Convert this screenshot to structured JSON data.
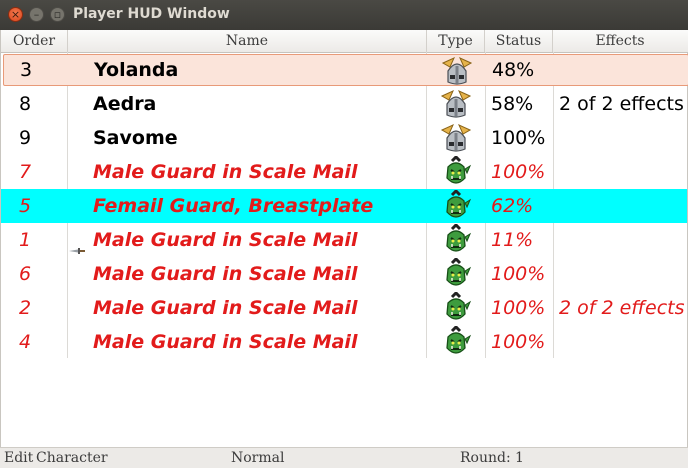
{
  "window": {
    "title": "Player HUD Window"
  },
  "columns": {
    "order": "Order",
    "name": "Name",
    "type": "Type",
    "status": "Status",
    "effects": "Effects"
  },
  "rows": [
    {
      "order": "3",
      "name": "Yolanda",
      "type": "adventurer-helmet-icon",
      "status": "48%",
      "effects": "",
      "style": "player",
      "state": "selected"
    },
    {
      "order": "8",
      "name": "Aedra",
      "type": "adventurer-helmet-icon",
      "status": "58%",
      "effects": "2 of 2 effects",
      "style": "player",
      "state": ""
    },
    {
      "order": "9",
      "name": "Savome",
      "type": "adventurer-helmet-icon",
      "status": "100%",
      "effects": "",
      "style": "player",
      "state": ""
    },
    {
      "order": "7",
      "name": "Male Guard in Scale Mail",
      "type": "orc-head-icon",
      "status": "100%",
      "effects": "",
      "style": "enemy",
      "state": ""
    },
    {
      "order": "5",
      "name": "Femail Guard, Breastplate",
      "type": "orc-head-icon",
      "status": "62%",
      "effects": "",
      "style": "enemy",
      "state": "highlighted"
    },
    {
      "order": "1",
      "name": "Male Guard in Scale Mail",
      "type": "orc-head-icon",
      "status": "11%",
      "effects": "",
      "style": "enemy",
      "state": "current-turn"
    },
    {
      "order": "6",
      "name": "Male Guard in Scale Mail",
      "type": "orc-head-icon",
      "status": "100%",
      "effects": "",
      "style": "enemy",
      "state": ""
    },
    {
      "order": "2",
      "name": "Male Guard in Scale Mail",
      "type": "orc-head-icon",
      "status": "100%",
      "effects": "2 of 2 effects",
      "style": "enemy",
      "state": ""
    },
    {
      "order": "4",
      "name": "Male Guard in Scale Mail",
      "type": "orc-head-icon",
      "status": "100%",
      "effects": "",
      "style": "enemy",
      "state": ""
    }
  ],
  "statusbar": {
    "edit": "Edit",
    "character": "Character",
    "mode": "Normal",
    "round_label": "Round:",
    "round_value": "1"
  },
  "colors": {
    "enemy_text": "#e21b1b",
    "player_text": "#000000",
    "highlight_row": "#00ffff",
    "selected_row": "#fbe4da"
  }
}
